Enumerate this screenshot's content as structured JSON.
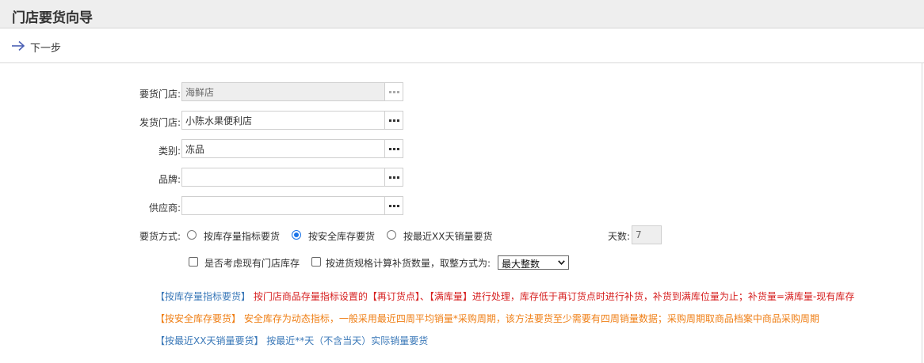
{
  "header": {
    "title": "门店要货向导"
  },
  "toolbar": {
    "next_label": "下一步"
  },
  "form": {
    "request_store": {
      "label": "要货门店:",
      "value": "海鲜店"
    },
    "ship_store": {
      "label": "发货门店:",
      "value": "小陈水果便利店"
    },
    "category": {
      "label": "类别:",
      "value": "冻品"
    },
    "brand": {
      "label": "品牌:",
      "value": ""
    },
    "supplier": {
      "label": "供应商:",
      "value": ""
    },
    "method": {
      "label": "要货方式:",
      "options": [
        "按库存量指标要货",
        "按安全库存要货",
        "按最近XX天销量要货"
      ],
      "selected": "按安全库存要货"
    },
    "days": {
      "label": "天数:",
      "value": "7"
    },
    "consider_stock": {
      "label": "是否考虑现有门店库存",
      "checked": false
    },
    "calc_by_spec": {
      "label": "按进货规格计算补货数量，取整方式为:",
      "checked": false
    },
    "rounding": {
      "value": "最大整数"
    }
  },
  "notes": {
    "stock_indicator": {
      "tag": "【按库存量指标要货】",
      "text": "按门店商品存量指标设置的【再订货点】、【满库量】进行处理，库存低于再订货点时进行补货，补货到满库位量为止；补货量=满库量-现有库存"
    },
    "safety_stock": {
      "tag": "【按安全库存要货】",
      "text": "安全库存为动态指标，一般采用最近四周平均销量*采购周期，该方法要货至少需要有四周销量数据；采购周期取商品档案中商品采购周期"
    },
    "recent_sales": {
      "tag": "【按最近XX天销量要货】",
      "text": "按最近**天（不含当天）实际销量要货"
    }
  },
  "colors": {
    "note_blue": "#3a78b8",
    "note_red": "#d61f1f",
    "note_orange": "#ef7f16",
    "radio_accent": "#1a73e8"
  }
}
